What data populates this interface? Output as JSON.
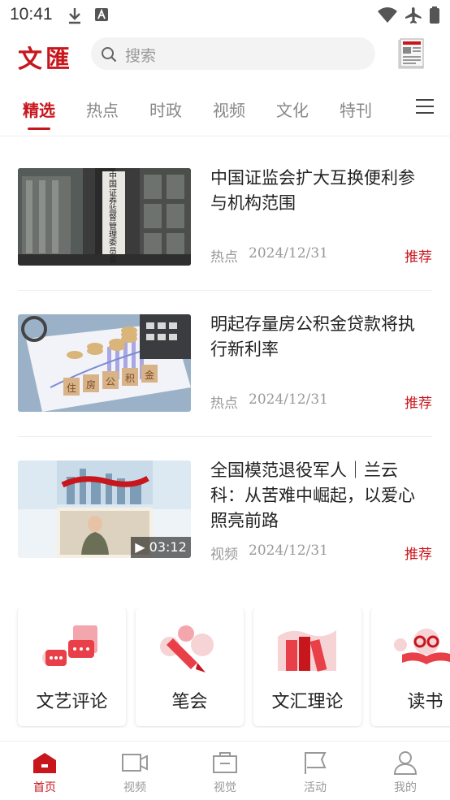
{
  "status_bar": {
    "time": "10:41"
  },
  "header": {
    "logo": "文匯",
    "search_placeholder": "搜索"
  },
  "tabs": [
    {
      "label": "精选",
      "active": true
    },
    {
      "label": "热点"
    },
    {
      "label": "时政"
    },
    {
      "label": "视频"
    },
    {
      "label": "文化"
    },
    {
      "label": "特刊"
    }
  ],
  "articles": [
    {
      "title": "中国证监会扩大互换便利参与机构范围",
      "category": "热点",
      "date": "2024/12/31",
      "tag": "推荐"
    },
    {
      "title": "明起存量房公积金贷款将执行新利率",
      "category": "热点",
      "date": "2024/12/31",
      "tag": "推荐"
    },
    {
      "title": "全国模范退役军人｜兰云科：从苦难中崛起，以爱心照亮前路",
      "category": "视频",
      "date": "2024/12/31",
      "tag": "推荐",
      "duration": "03:12"
    }
  ],
  "thumb_text": {
    "sign": "中国证券监督管理委员会",
    "blocks": [
      "住",
      "房",
      "公",
      "积",
      "金"
    ]
  },
  "columns": [
    {
      "label": "文艺评论"
    },
    {
      "label": "笔会"
    },
    {
      "label": "文汇理论"
    },
    {
      "label": "读书"
    }
  ],
  "bottom_nav": [
    {
      "label": "首页",
      "active": true
    },
    {
      "label": "视频"
    },
    {
      "label": "视觉"
    },
    {
      "label": "活动"
    },
    {
      "label": "我的"
    }
  ],
  "colors": {
    "accent": "#c8161d"
  }
}
